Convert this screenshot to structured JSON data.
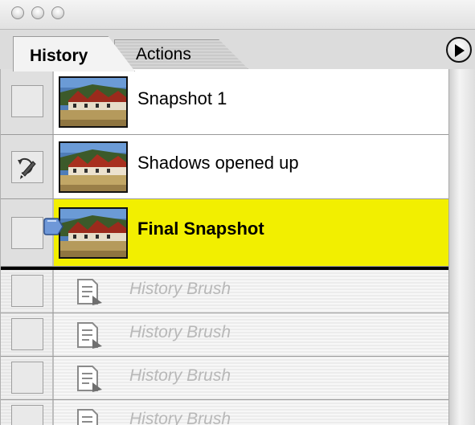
{
  "window": {
    "traffic_lights": [
      "close",
      "minimize",
      "zoom"
    ]
  },
  "tabs": [
    {
      "label": "History",
      "active": true
    },
    {
      "label": "Actions",
      "active": false
    }
  ],
  "panel_menu_icon": "play-triangle-icon",
  "snapshots": [
    {
      "label": "Snapshot 1",
      "source_icon": "",
      "active": false
    },
    {
      "label": "Shadows opened up",
      "source_icon": "history-brush-source-icon",
      "active": false
    },
    {
      "label": "Final Snapshot",
      "source_icon": "",
      "active": true
    }
  ],
  "history_steps": [
    {
      "label": "History Brush",
      "icon": "history-state-document-icon"
    },
    {
      "label": "History Brush",
      "icon": "history-state-document-icon"
    },
    {
      "label": "History Brush",
      "icon": "history-state-document-icon"
    },
    {
      "label": "History Brush",
      "icon": "history-state-document-icon"
    }
  ],
  "colors": {
    "active_row": "#f2ef00",
    "disabled_text": "#b8b8b8",
    "divider": "#000000"
  }
}
